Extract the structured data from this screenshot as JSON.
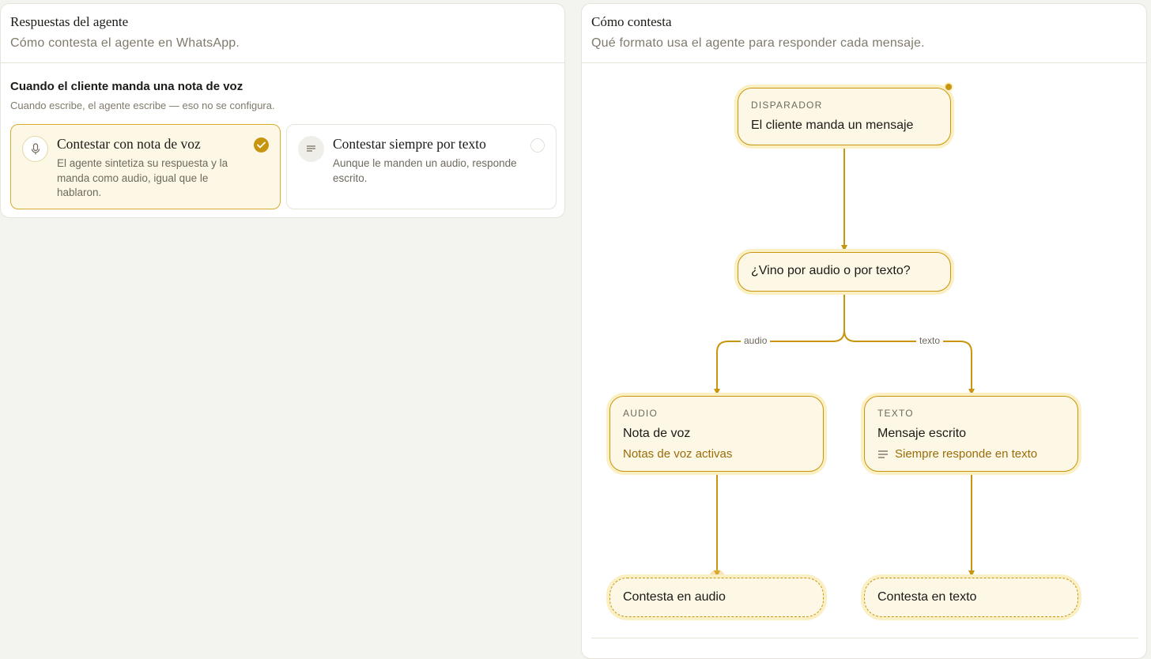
{
  "left_panel": {
    "title": "Respuestas del agente",
    "subtitle": "Cómo contesta el agente en WhatsApp.",
    "section": {
      "title": "Cuando el cliente manda una nota de voz",
      "subtitle": "Cuando escribe, el agente escribe — eso no se configura."
    },
    "options": [
      {
        "icon": "microphone-icon",
        "title": "Contestar con nota de voz",
        "description": "El agente sintetiza su respuesta y la manda como audio, igual que le hablaron.",
        "selected": true
      },
      {
        "icon": "text-lines-icon",
        "title": "Contestar siempre por texto",
        "description": "Aunque le manden un audio, responde escrito.",
        "selected": false
      }
    ]
  },
  "right_panel": {
    "title": "Cómo contesta",
    "subtitle": "Qué formato usa el agente para responder cada mensaje.",
    "flow": {
      "trigger": {
        "kicker": "DISPARADOR",
        "title": "El cliente manda un mensaje"
      },
      "decision": {
        "title": "¿Vino por audio o por texto?"
      },
      "edges": {
        "audio": "audio",
        "texto": "texto"
      },
      "audio_node": {
        "kicker": "AUDIO",
        "title": "Nota de voz",
        "sub": "Notas de voz activas"
      },
      "text_node": {
        "kicker": "TEXTO",
        "title": "Mensaje escrito",
        "sub": "Siempre responde en texto"
      },
      "audio_result": {
        "title": "Contesta en audio"
      },
      "text_result": {
        "title": "Contesta en texto"
      }
    }
  },
  "colors": {
    "accent": "#c8950f",
    "accent_soft": "#fdf8e6",
    "halo": "#fbefc4",
    "muted_text": "#807a6c"
  }
}
